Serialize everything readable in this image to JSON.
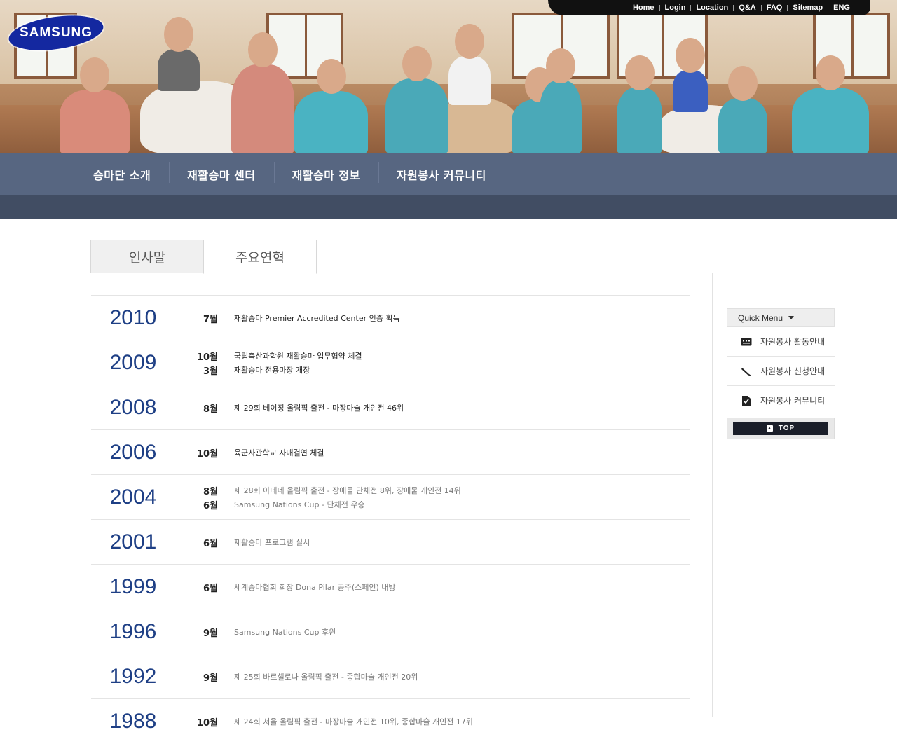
{
  "header": {
    "logo_text": "SAMSUNG",
    "util_links": [
      "Home",
      "Login",
      "Location",
      "Q&A",
      "FAQ",
      "Sitemap",
      "ENG"
    ]
  },
  "nav": {
    "items": [
      "승마단 소개",
      "재활승마 센터",
      "재활승마 정보",
      "자원봉사 커뮤니티"
    ]
  },
  "tabs": [
    "인사말",
    "주요연혁"
  ],
  "active_tab": "주요연혁",
  "history": [
    {
      "year": "2010",
      "events": [
        {
          "month": "7월",
          "text": "재활승마 Premier Accredited Center 인증 획득"
        }
      ]
    },
    {
      "year": "2009",
      "events": [
        {
          "month": "10월",
          "text": "국립축산과학원 재활승마 업무협약 체결"
        },
        {
          "month": "3월",
          "text": "재활승마 전용마장 개장"
        }
      ]
    },
    {
      "year": "2008",
      "events": [
        {
          "month": "8월",
          "text": "제 29회 베이징 올림픽 출전 - 마장마술 개인전 46위"
        }
      ]
    },
    {
      "year": "2006",
      "events": [
        {
          "month": "10월",
          "text": "육군사관학교 자매결연 체결"
        }
      ]
    },
    {
      "year": "2004",
      "events": [
        {
          "month": "8월",
          "text": "제 28회 아테네 올림픽 출전 - 장애물 단체전 8위, 장애물 개인전 14위"
        },
        {
          "month": "6월",
          "text": "Samsung Nations Cup - 단체전 우승"
        }
      ]
    },
    {
      "year": "2001",
      "events": [
        {
          "month": "6월",
          "text": "재활승마 프로그램 실시"
        }
      ]
    },
    {
      "year": "1999",
      "events": [
        {
          "month": "6월",
          "text": "세계승마협회 회장 Dona Pilar 공주(스페인) 내방"
        }
      ]
    },
    {
      "year": "1996",
      "events": [
        {
          "month": "9월",
          "text": "Samsung Nations Cup 후원"
        }
      ]
    },
    {
      "year": "1992",
      "events": [
        {
          "month": "9월",
          "text": "제 25회 바르셀로나 올림픽 출전 - 종합마술 개인전 20위"
        }
      ]
    },
    {
      "year": "1988",
      "events": [
        {
          "month": "10월",
          "text": "제 24회 서울 올림픽 출전 - 마장마술 개인전 10위, 종합마술 개인전 17위"
        }
      ]
    }
  ],
  "quick_menu": {
    "title": "Quick Menu",
    "items": [
      "자원봉사 활동안내",
      "자원봉사 신청안내",
      "자원봉사 커뮤니티"
    ],
    "top_label": "TOP"
  },
  "colors": {
    "nav": "#576681",
    "subnav": "#414d63",
    "year": "#1e3f85",
    "logo": "#1428a0"
  }
}
